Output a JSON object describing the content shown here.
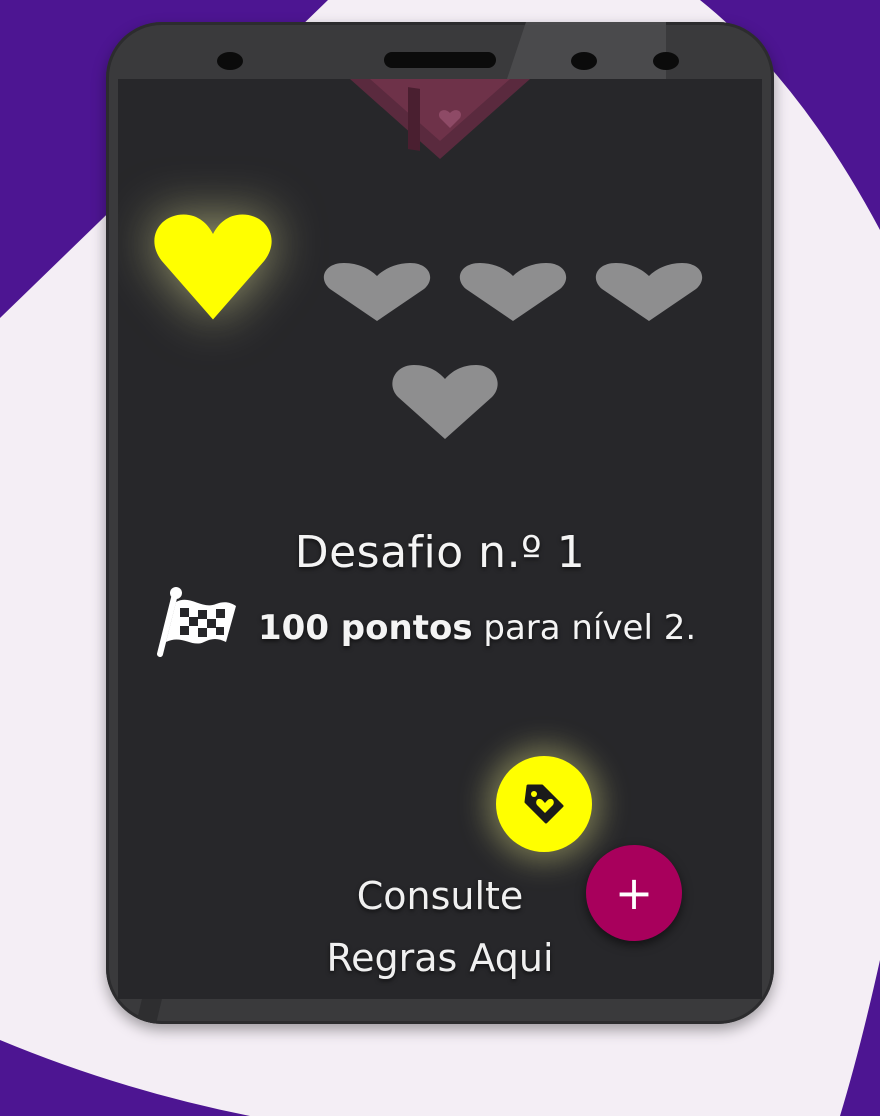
{
  "colors": {
    "background": "#f4eef5",
    "accent_purple": "#4d1592",
    "phone_body": "#3a3a3c",
    "screen": "#27272a",
    "heart_active": "#ffff00",
    "heart_inactive": "#8e8e8f",
    "plus_button": "#a8005c"
  },
  "challenge": {
    "title": "Desafio n.º 1",
    "points": "100 pontos",
    "goal_suffix": "para nível 2."
  },
  "lives": {
    "total": 5,
    "active": 1
  },
  "rules_link": {
    "line1": "Consulte",
    "line2": "Regras Aqui"
  },
  "buttons": {
    "plus": "+"
  },
  "icons": {
    "flag": "checkered-flag-icon",
    "tag": "tag-heart-icon",
    "gift": "gift-box-icon"
  }
}
